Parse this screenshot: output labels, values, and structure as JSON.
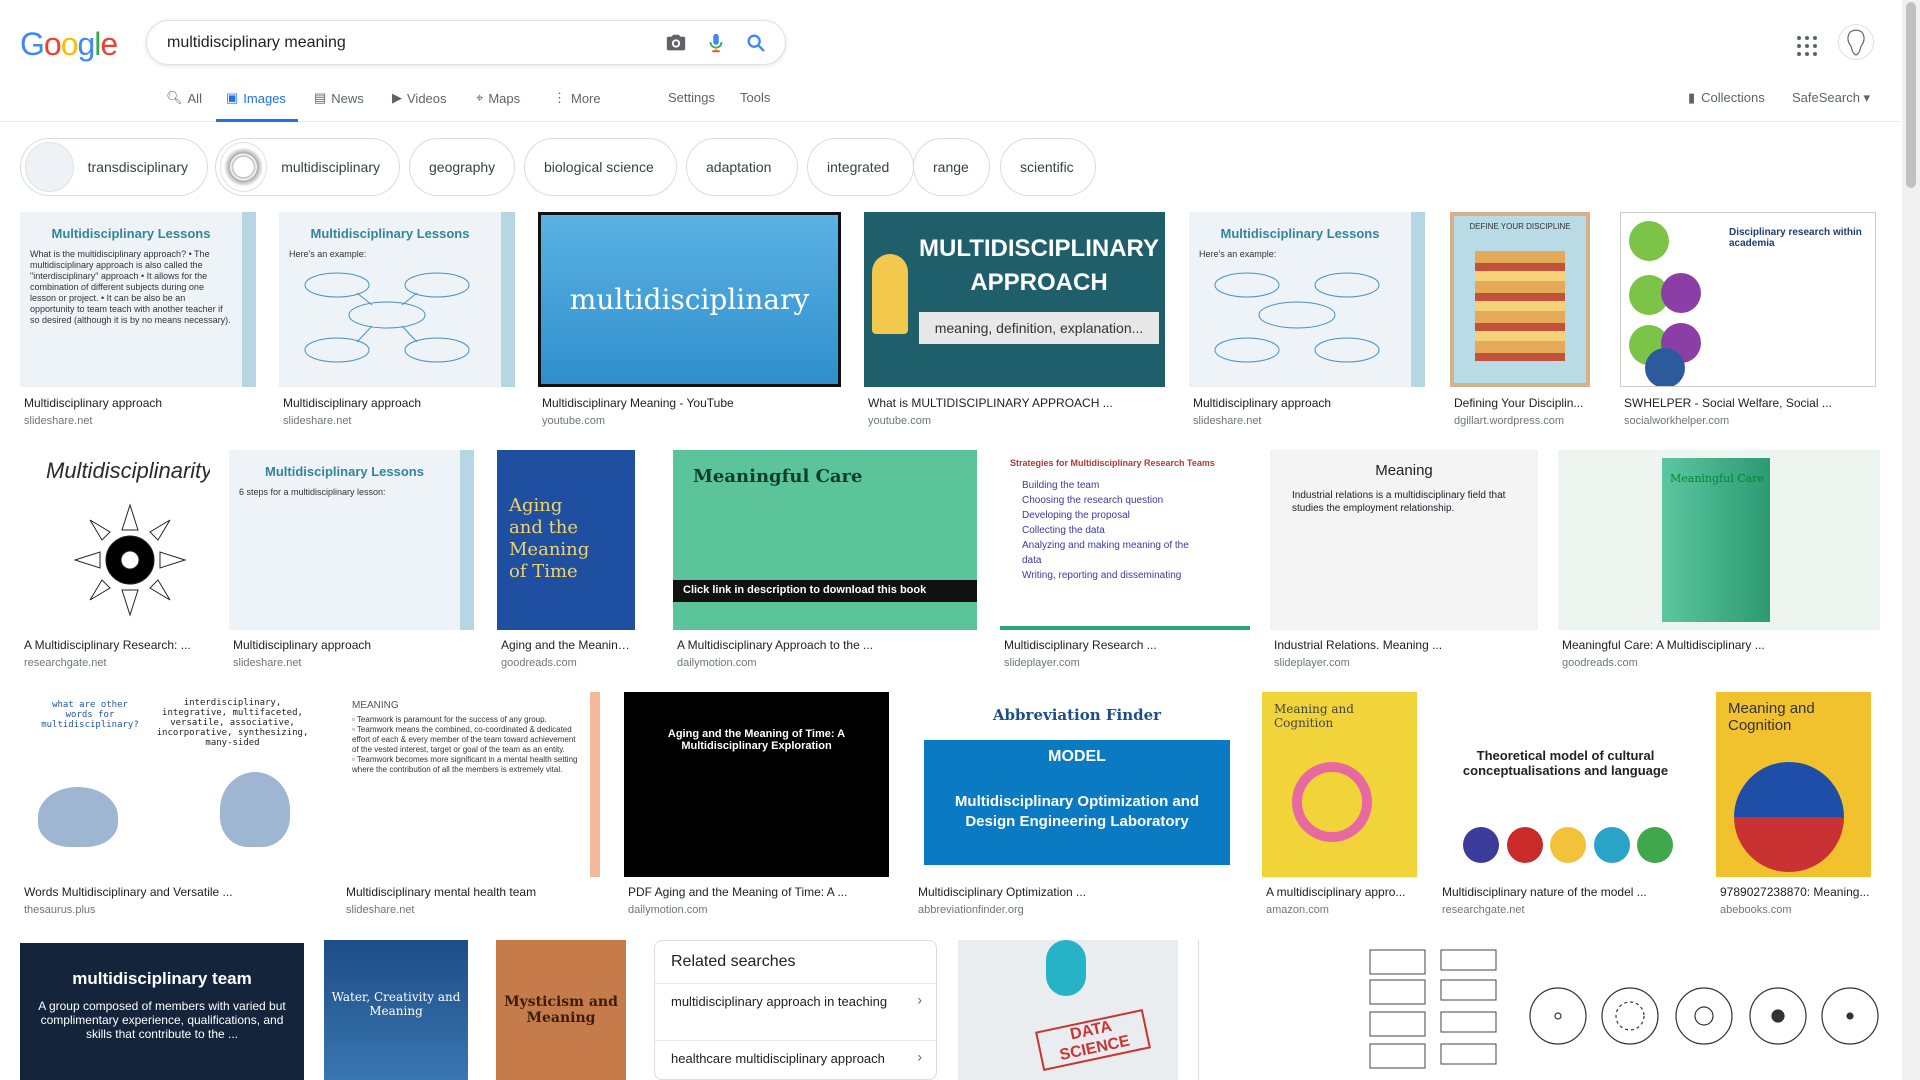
{
  "logo": {
    "letters": [
      "G",
      "o",
      "o",
      "g",
      "l",
      "e"
    ],
    "colors": [
      "#4285F4",
      "#EA4335",
      "#FBBC05",
      "#4285F4",
      "#34A853",
      "#EA4335"
    ]
  },
  "search": {
    "query": "multidisciplinary meaning"
  },
  "tabs": [
    {
      "label": "All",
      "icon": "search-icon"
    },
    {
      "label": "Images",
      "icon": "images-icon",
      "active": true
    },
    {
      "label": "News",
      "icon": "news-icon"
    },
    {
      "label": "Videos",
      "icon": "videos-icon"
    },
    {
      "label": "Maps",
      "icon": "maps-icon"
    },
    {
      "label": "More",
      "icon": "more-vert-icon"
    }
  ],
  "settings": "Settings",
  "tools": "Tools",
  "collections": "Collections",
  "safesearch": "SafeSearch",
  "chips": [
    "transdisciplinary",
    "multidisciplinary",
    "geography",
    "biological science",
    "adaptation",
    "integrated",
    "range",
    "scientific"
  ],
  "results": [
    {
      "title": "Multidisciplinary approach",
      "source": "slideshare.net",
      "heading": "Multidisciplinary Lessons",
      "body": "What is the multidisciplinary approach? • The multidisciplinary approach is also called the \"interdisciplinary\" approach • It allows for the combination of different subjects during one lesson or project. • It can be also be an opportunity to team teach with another teacher if so desired (although it is by no means necessary)."
    },
    {
      "title": "Multidisciplinary approach",
      "source": "slideshare.net",
      "heading": "Multidisciplinary Lessons",
      "body": "Here's an example:"
    },
    {
      "title": "Multidisciplinary Meaning - YouTube",
      "source": "youtube.com",
      "heading": "multidisciplinary"
    },
    {
      "title": "What is MULTIDISCIPLINARY APPROACH ...",
      "source": "youtube.com",
      "heading": "MULTIDISCIPLINARY APPROACH",
      "body": "meaning, definition, explanation..."
    },
    {
      "title": "Multidisciplinary approach",
      "source": "slideshare.net",
      "heading": "Multidisciplinary Lessons",
      "body": "Here's an example:"
    },
    {
      "title": "Defining Your Disciplin...",
      "source": "dgillart.wordpress.com",
      "heading": "DEFINE YOUR DISCIPLINE"
    },
    {
      "title": "SWHELPER - Social Welfare, Social ...",
      "source": "socialworkhelper.com",
      "heading": "Disciplinary research within academia"
    },
    {
      "title": "A Multidisciplinary Research: ...",
      "source": "researchgate.net",
      "heading": "Multidisciplinarity"
    },
    {
      "title": "Multidisciplinary approach",
      "source": "slideshare.net",
      "heading": "Multidisciplinary Lessons",
      "body": "6 steps for a multidisciplinary lesson:"
    },
    {
      "title": "Aging and the Meaning ...",
      "source": "goodreads.com",
      "heading": "Aging and the Meaning of Time"
    },
    {
      "title": "A Multidisciplinary Approach to the ...",
      "source": "dailymotion.com",
      "heading": "Meaningful Care",
      "body": "Click link in description to download this book"
    },
    {
      "title": "Multidisciplinary Research ...",
      "source": "slideplayer.com",
      "heading": "Strategies for Multidisciplinary Research Teams",
      "body": "Building the team|Choosing the research question|Developing the proposal|Collecting the data|Analyzing and making meaning of the data|Writing, reporting and disseminating"
    },
    {
      "title": "Industrial Relations. Meaning ...",
      "source": "slideplayer.com",
      "heading": "Meaning",
      "body": "Industrial relations is a multidisciplinary field that studies the employment relationship."
    },
    {
      "title": "Meaningful Care: A Multidisciplinary ...",
      "source": "goodreads.com",
      "heading": "Meaningful Care"
    },
    {
      "title": "Words Multidisciplinary and Versatile ...",
      "source": "thesaurus.plus",
      "heading": "what are other words for multidisciplinary?",
      "body": "interdisciplinary, integrative, multifaceted, versatile, associative, incorporative, synthesizing, many-sided"
    },
    {
      "title": "Multidisciplinary mental health team",
      "source": "slideshare.net",
      "heading": "MEANING"
    },
    {
      "title": "PDF Aging and the Meaning of Time: A ...",
      "source": "dailymotion.com",
      "heading": "Aging and the Meaning of Time: A Multidisciplinary Exploration"
    },
    {
      "title": "Multidisciplinary Optimization ...",
      "source": "abbreviationfinder.org",
      "heading": "MODEL",
      "body": "Multidisciplinary Optimization and Design Engineering Laboratory"
    },
    {
      "title": "A multidisciplinary appro...",
      "source": "amazon.com",
      "heading": "Meaning and Cognition"
    },
    {
      "title": "Multidisciplinary nature of the model ...",
      "source": "researchgate.net",
      "heading": "Theoretical model of cultural conceptualisations and language"
    },
    {
      "title": "9789027238870: Meaning...",
      "source": "abebooks.com",
      "heading": "Meaning and Cognition"
    },
    {
      "heading": "multidisciplinary team",
      "body": "A group composed of members with varied but complimentary experience, qualifications, and skills that contribute to the ..."
    },
    {
      "heading": "Water, Creativity and Meaning"
    },
    {
      "heading": "Mysticism and Meaning"
    },
    {
      "heading": "DATA SCIENCE"
    }
  ],
  "related": {
    "title": "Related searches",
    "items": [
      "multidisciplinary approach in teaching",
      "healthcare multidisciplinary approach"
    ]
  }
}
